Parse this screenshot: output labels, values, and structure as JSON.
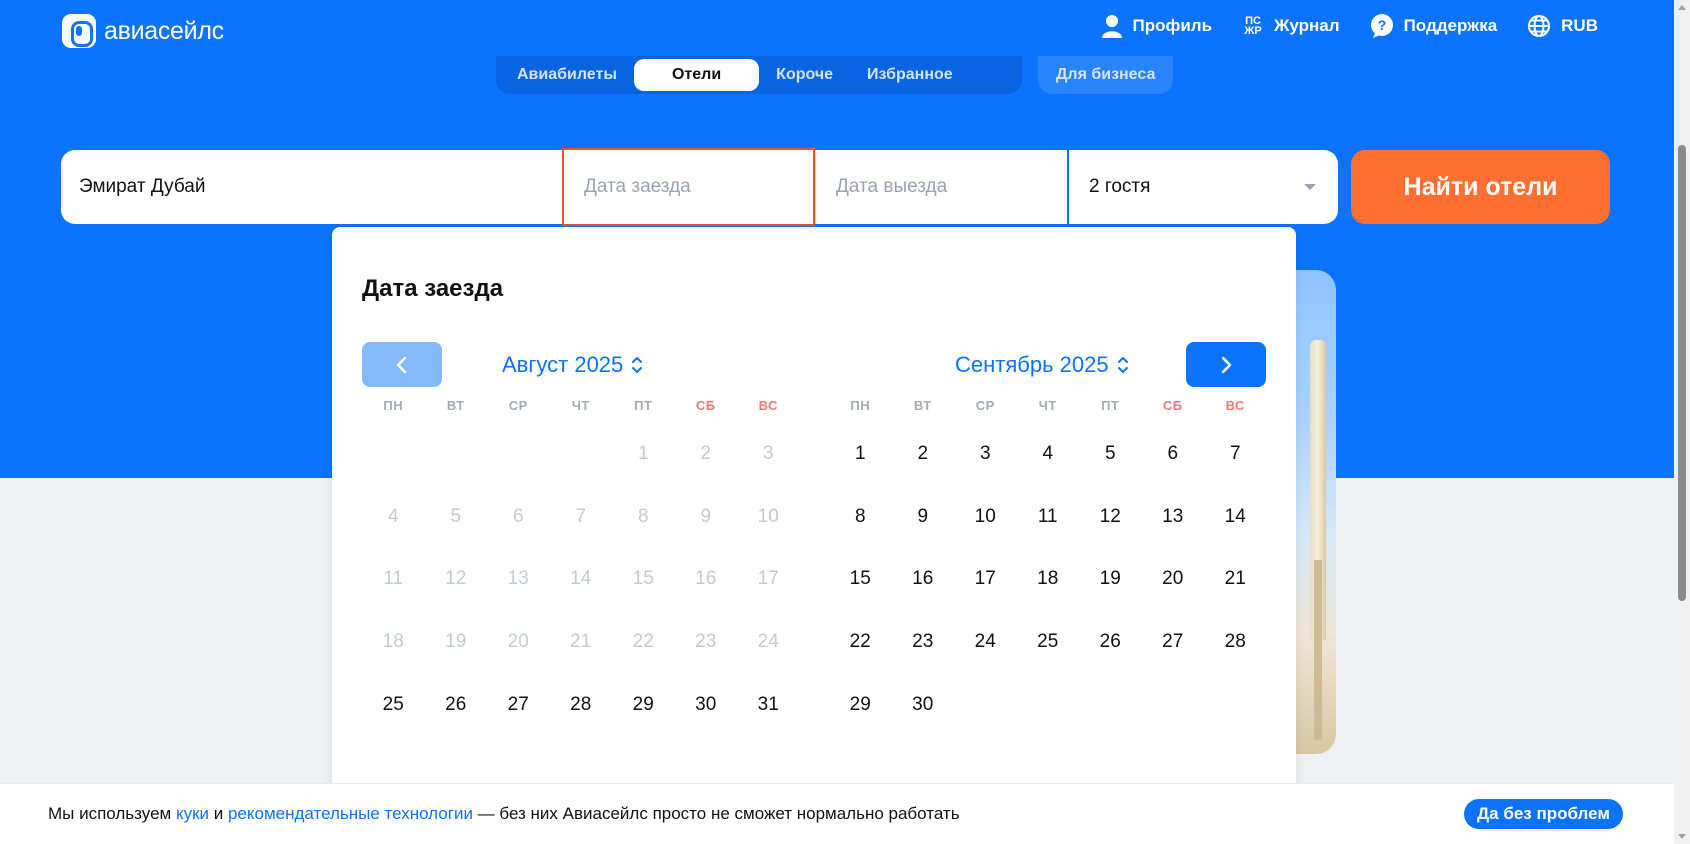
{
  "header": {
    "logo_text": "авиасейлс",
    "nav": [
      {
        "label": "Профиль",
        "icon": "person-icon"
      },
      {
        "label": "Журнал",
        "icon": "journal-icon",
        "icon_text": "ПС ЖР"
      },
      {
        "label": "Поддержка",
        "icon": "help-icon"
      },
      {
        "label": "RUB",
        "icon": "globe-icon"
      }
    ]
  },
  "tabs": {
    "items": [
      "Авиабилеты",
      "Отели",
      "Короче",
      "Избранное"
    ],
    "active": "Отели",
    "business": "Для бизнеса"
  },
  "search": {
    "destination": "Эмират Дубай",
    "checkin_placeholder": "Дата заезда",
    "checkout_placeholder": "Дата выезда",
    "guests": "2 гостя",
    "button": "Найти отели"
  },
  "calendar": {
    "title": "Дата заезда",
    "weekdays": [
      "ПН",
      "ВТ",
      "СР",
      "ЧТ",
      "ПТ",
      "СБ",
      "ВС"
    ],
    "months": [
      {
        "title": "Август 2025",
        "offset": 4,
        "days": [
          "1",
          "2",
          "3",
          "4",
          "5",
          "6",
          "7",
          "8",
          "9",
          "10",
          "11",
          "12",
          "13",
          "14",
          "15",
          "16",
          "17",
          "18",
          "19",
          "20",
          "21",
          "22",
          "23",
          "24",
          "25",
          "26",
          "27",
          "28",
          "29",
          "30",
          "31"
        ],
        "disabled_until": 24
      },
      {
        "title": "Сентябрь 2025",
        "offset": 0,
        "days": [
          "1",
          "2",
          "3",
          "4",
          "5",
          "6",
          "7",
          "8",
          "9",
          "10",
          "11",
          "12",
          "13",
          "14",
          "15",
          "16",
          "17",
          "18",
          "19",
          "20",
          "21",
          "22",
          "23",
          "24",
          "25",
          "26",
          "27",
          "28",
          "29",
          "30"
        ],
        "disabled_until": 0
      }
    ]
  },
  "cookie": {
    "text_1": "Мы используем ",
    "link_1": "куки",
    "text_2": " и ",
    "link_2": "рекомендательные технологии",
    "text_3": " — без них Авиасейлс просто не сможет нормально работать",
    "button": "Да без проблем"
  },
  "colors": {
    "brand_blue": "#0c73fe",
    "orange": "#ff6f32",
    "error_red": "#e2552f",
    "weekend_red": "#f0787a"
  }
}
